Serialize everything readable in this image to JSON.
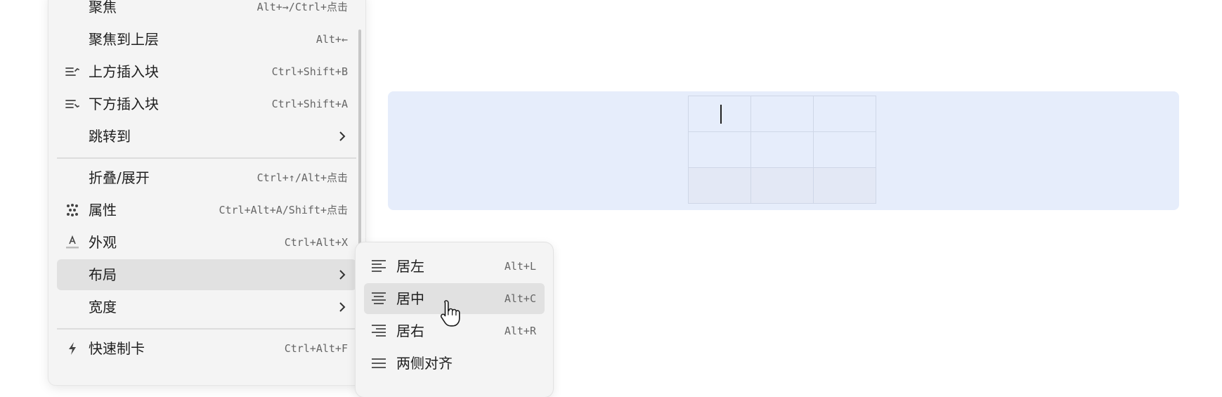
{
  "context_menu": {
    "items": [
      {
        "label": "聚焦",
        "shortcut": "Alt+→/Ctrl+点击",
        "icon": "",
        "submenu": false
      },
      {
        "label": "聚焦到上层",
        "shortcut": "Alt+←",
        "icon": "",
        "submenu": false
      },
      {
        "label": "上方插入块",
        "shortcut": "Ctrl+Shift+B",
        "icon": "insert-above-icon",
        "submenu": false
      },
      {
        "label": "下方插入块",
        "shortcut": "Ctrl+Shift+A",
        "icon": "insert-below-icon",
        "submenu": false
      },
      {
        "label": "跳转到",
        "shortcut": "",
        "icon": "",
        "submenu": true
      },
      {
        "label": "折叠/展开",
        "shortcut": "Ctrl+↑/Alt+点击",
        "icon": "",
        "submenu": false
      },
      {
        "label": "属性",
        "shortcut": "Ctrl+Alt+A/Shift+点击",
        "icon": "attribute-icon",
        "submenu": false
      },
      {
        "label": "外观",
        "shortcut": "Ctrl+Alt+X",
        "icon": "appearance-icon",
        "submenu": false
      },
      {
        "label": "布局",
        "shortcut": "",
        "icon": "",
        "submenu": true,
        "active": true
      },
      {
        "label": "宽度",
        "shortcut": "",
        "icon": "",
        "submenu": true
      },
      {
        "label": "快速制卡",
        "shortcut": "Ctrl+Alt+F",
        "icon": "lightning-icon",
        "submenu": false
      }
    ]
  },
  "layout_submenu": {
    "items": [
      {
        "label": "居左",
        "shortcut": "Alt+L",
        "icon": "align-left-icon"
      },
      {
        "label": "居中",
        "shortcut": "Alt+C",
        "icon": "align-center-icon",
        "active": true
      },
      {
        "label": "居右",
        "shortcut": "Alt+R",
        "icon": "align-right-icon"
      },
      {
        "label": "两侧对齐",
        "shortcut": "",
        "icon": "align-justify-icon"
      }
    ]
  },
  "table": {
    "rows": 3,
    "columns": 3
  },
  "colors": {
    "block_highlight": "#e6edfb",
    "menu_bg": "#f4f4f4",
    "active_item": "#e1e1e1"
  }
}
